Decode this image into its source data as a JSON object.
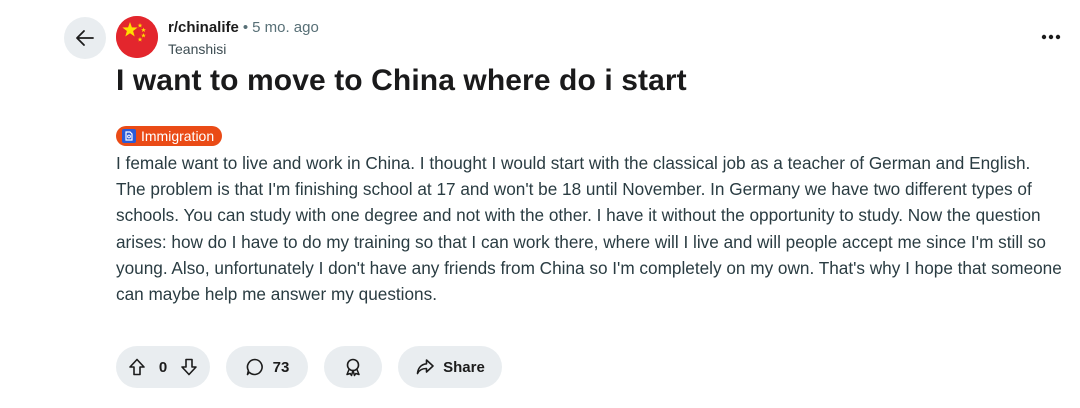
{
  "post": {
    "subreddit": "r/chinalife",
    "separator": "•",
    "age": "5 mo. ago",
    "author": "Teanshisi",
    "title": "I want to move to China where do i start",
    "flair": {
      "label": "Immigration",
      "icon": "passport-icon",
      "color": "#ea4b16"
    },
    "body": "I female want to live and work in China. I thought I would start with the classical job as a teacher of German and English. The problem is that I'm finishing school at 17 and won't be 18 until November. In Germany we have two different types of schools. You can study with one degree and not with the other. I have it without the opportunity to study. Now the question arises: how do I have to do my training so that I can work there, where will I live and will people accept me since I'm still so young. Also, unfortunately I don't have any friends from China so I'm completely on my own. That's why I hope that someone can maybe help me answer my questions."
  },
  "actions": {
    "vote_count": "0",
    "comment_count": "73",
    "share_label": "Share"
  },
  "icons": {
    "back": "arrow-left-icon",
    "avatar": "china-flag-icon",
    "more": "more-horizontal-icon",
    "upvote": "upvote-arrow-icon",
    "downvote": "downvote-arrow-icon",
    "comment": "comment-bubble-icon",
    "award": "award-icon",
    "share": "share-arrow-icon"
  },
  "colors": {
    "flair_bg": "#ea4b16",
    "pill_bg": "#e9edf0",
    "avatar_bg": "#e3262d",
    "star": "#ffde00"
  }
}
